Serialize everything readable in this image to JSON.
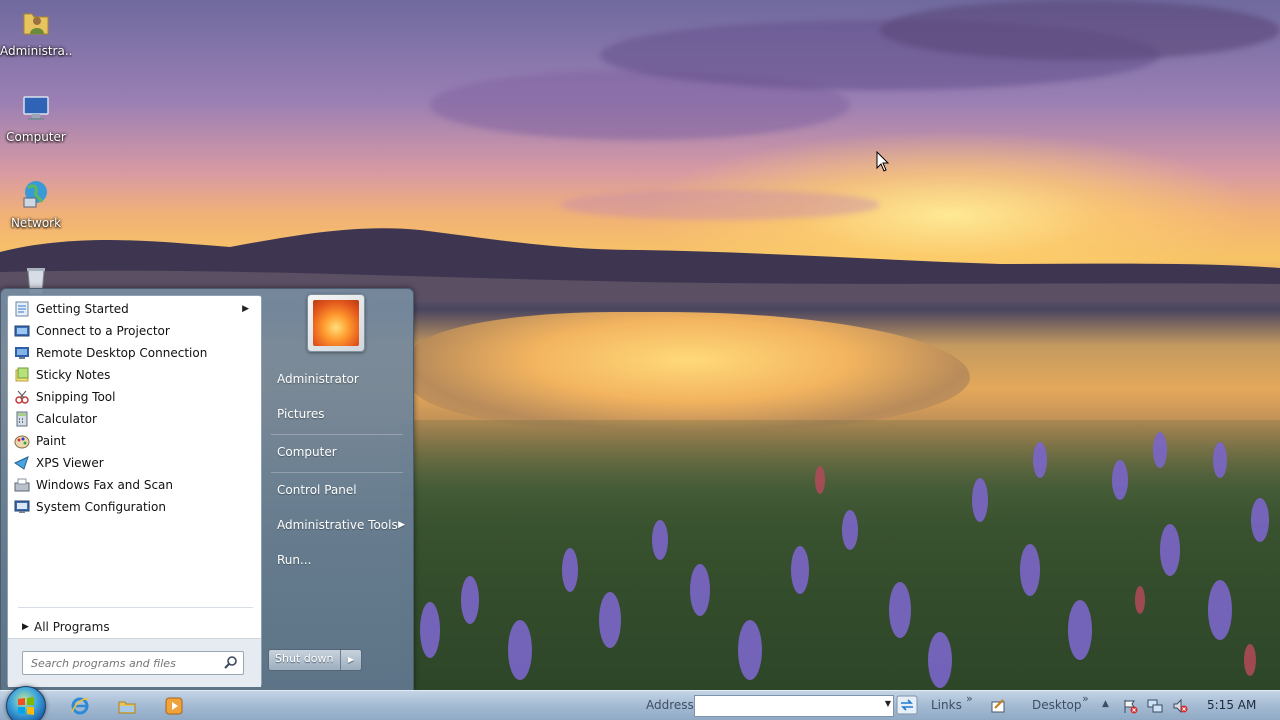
{
  "desktop": {
    "icons": [
      {
        "label": "Administra...",
        "icon": "user-folder-icon"
      },
      {
        "label": "Computer",
        "icon": "computer-icon"
      },
      {
        "label": "Network",
        "icon": "network-icon"
      },
      {
        "label": "",
        "icon": "recycle-bin-icon"
      }
    ]
  },
  "start_menu": {
    "programs": [
      {
        "label": "Getting Started",
        "icon": "getting-started-icon",
        "has_submenu": true
      },
      {
        "label": "Connect to a Projector",
        "icon": "projector-icon",
        "has_submenu": false
      },
      {
        "label": "Remote Desktop Connection",
        "icon": "remote-desktop-icon",
        "has_submenu": false
      },
      {
        "label": "Sticky Notes",
        "icon": "sticky-notes-icon",
        "has_submenu": false
      },
      {
        "label": "Snipping Tool",
        "icon": "snipping-tool-icon",
        "has_submenu": false
      },
      {
        "label": "Calculator",
        "icon": "calculator-icon",
        "has_submenu": false
      },
      {
        "label": "Paint",
        "icon": "paint-icon",
        "has_submenu": false
      },
      {
        "label": "XPS Viewer",
        "icon": "xps-viewer-icon",
        "has_submenu": false
      },
      {
        "label": "Windows Fax and Scan",
        "icon": "fax-scan-icon",
        "has_submenu": false
      },
      {
        "label": "System Configuration",
        "icon": "system-configuration-icon",
        "has_submenu": false
      }
    ],
    "all_programs": "All Programs",
    "search_placeholder": "Search programs and files",
    "right_items": [
      {
        "label": "Administrator",
        "has_submenu": false
      },
      {
        "label": "Pictures",
        "has_submenu": false
      },
      {
        "label": "Computer",
        "has_submenu": false
      },
      {
        "label": "Control Panel",
        "has_submenu": false
      },
      {
        "label": "Administrative Tools",
        "has_submenu": true
      },
      {
        "label": "Run...",
        "has_submenu": false
      }
    ],
    "shutdown_label": "Shut down"
  },
  "taskbar": {
    "pinned": [
      {
        "name": "internet-explorer-icon"
      },
      {
        "name": "windows-explorer-icon"
      },
      {
        "name": "media-player-icon"
      }
    ],
    "address_label": "Address",
    "address_value": "",
    "links_label": "Links",
    "desktop_label": "Desktop",
    "chevron": "»",
    "clock": "5:15 AM"
  },
  "colors": {
    "taskbar": "#a6bcd4",
    "start_menu_frame": "#6f8aa3",
    "text_on_glass": "#ffffff"
  }
}
